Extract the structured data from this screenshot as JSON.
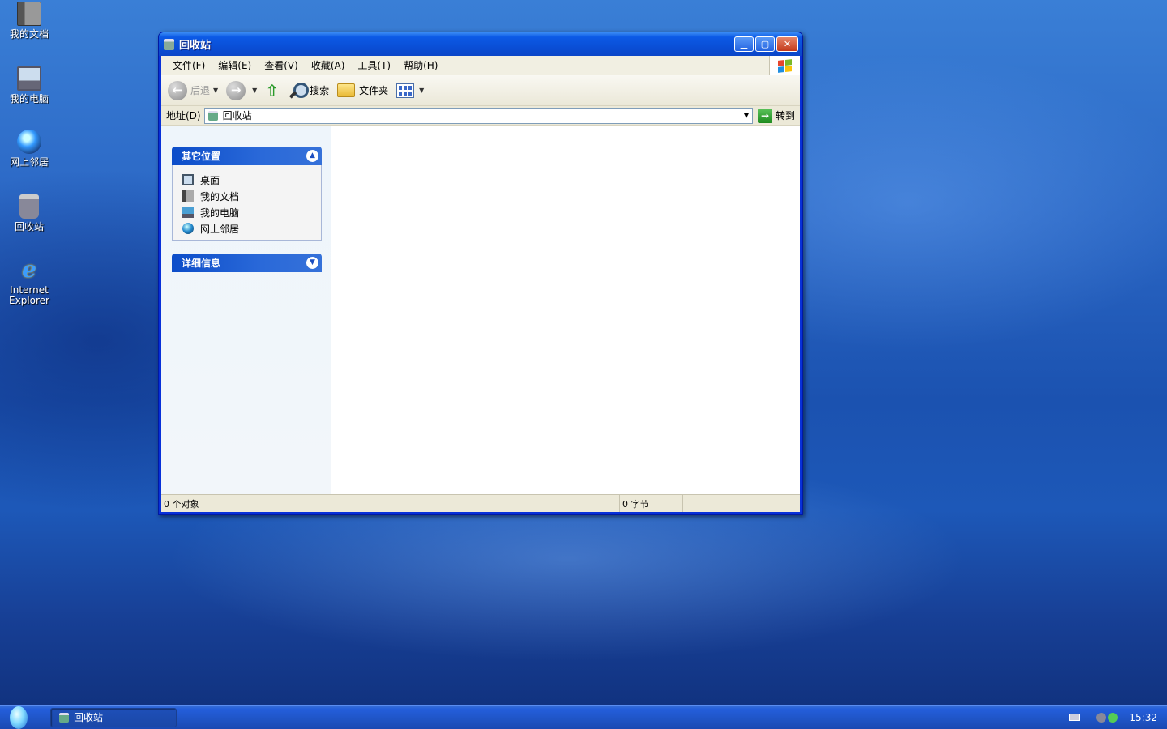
{
  "desktop": {
    "icons": [
      {
        "label": "我的文档",
        "icon": "my-documents-icon"
      },
      {
        "label": "我的电脑",
        "icon": "my-computer-icon"
      },
      {
        "label": "网上邻居",
        "icon": "network-places-icon"
      },
      {
        "label": "回收站",
        "icon": "recycle-bin-icon"
      },
      {
        "label_line1": "Internet",
        "label_line2": "Explorer",
        "icon": "internet-explorer-icon"
      }
    ],
    "ie_glyph": "e"
  },
  "window": {
    "title": "回收站",
    "buttons": {
      "minimize": "▁",
      "maximize": "▢",
      "close": "✕"
    },
    "menu": [
      "文件(F)",
      "编辑(E)",
      "查看(V)",
      "收藏(A)",
      "工具(T)",
      "帮助(H)"
    ],
    "toolbar": {
      "back": "后退",
      "search": "搜索",
      "folders": "文件夹"
    },
    "address": {
      "label": "地址(D)",
      "value": "回收站",
      "go": "转到"
    },
    "left_pane": {
      "other_places": {
        "title": "其它位置",
        "items": [
          "桌面",
          "我的文档",
          "我的电脑",
          "网上邻居"
        ]
      },
      "details": {
        "title": "详细信息"
      }
    },
    "status": {
      "objects": "0 个对象",
      "size": "0 字节"
    }
  },
  "taskbar": {
    "task_label": "回收站",
    "clock": "15:32"
  },
  "colors": {
    "title_blue": "#0a4fd7",
    "panel_blue": "#0c4dc9",
    "taskbar_blue": "#1f54c5"
  }
}
